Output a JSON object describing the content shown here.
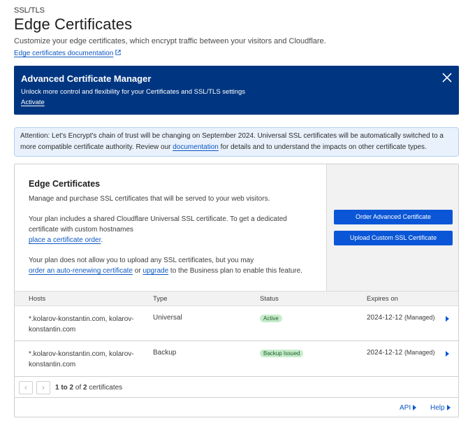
{
  "header": {
    "section": "SSL/TLS",
    "title": "Edge Certificates",
    "description": "Customize your edge certificates, which encrypt traffic between your visitors and Cloudflare.",
    "doc_link": "Edge certificates documentation"
  },
  "acm_banner": {
    "title": "Advanced Certificate Manager",
    "description": "Unlock more control and flexibility for your Certificates and SSL/TLS settings",
    "link": "Activate"
  },
  "notice": {
    "text_before": "Attention: Let's Encrypt's chain of trust will be changing on September 2024. Universal SSL certificates will be automatically switched to a more compatible certificate authority. Review our ",
    "link": "documentation",
    "text_after": " for details and to understand the impacts on other certificate types."
  },
  "card": {
    "title": "Edge Certificates",
    "p1": "Manage and purchase SSL certificates that will be served to your web visitors.",
    "p2": "Your plan includes a shared Cloudflare Universal SSL certificate. To get a dedicated certificate with custom hostnames",
    "p2_link": "place a certificate order",
    "p2_end": ".",
    "p3": "Your plan does not allow you to upload any SSL certificates, but you may",
    "p3_link1": "order an auto-renewing certificate",
    "p3_mid": " or ",
    "p3_link2": "upgrade",
    "p3_end": " to the Business plan to enable this feature.",
    "btn_order": "Order Advanced Certificate",
    "btn_upload": "Upload Custom SSL Certificate"
  },
  "table": {
    "headers": [
      "Hosts",
      "Type",
      "Status",
      "Expires on"
    ],
    "rows": [
      {
        "hosts": "*.kolarov-konstantin.com, kolarov-konstantin.com",
        "type": "Universal",
        "status": "Active",
        "expires": "2024-12-12",
        "managed": "(Managed)"
      },
      {
        "hosts": "*.kolarov-konstantin.com, kolarov-konstantin.com",
        "type": "Backup",
        "status": "Backup Issued",
        "expires": "2024-12-12",
        "managed": "(Managed)"
      }
    ]
  },
  "pagination": {
    "prev": "‹",
    "next": "›",
    "range": "1 to 2",
    "of": " of ",
    "total": "2",
    "suffix": " certificates"
  },
  "footer": {
    "api": "API",
    "help": "Help"
  },
  "colors": {
    "banner_bg": "#003681",
    "accent": "#0a56d6",
    "notice_bg": "#e9f2fc",
    "status_bg": "#c6eccb"
  }
}
